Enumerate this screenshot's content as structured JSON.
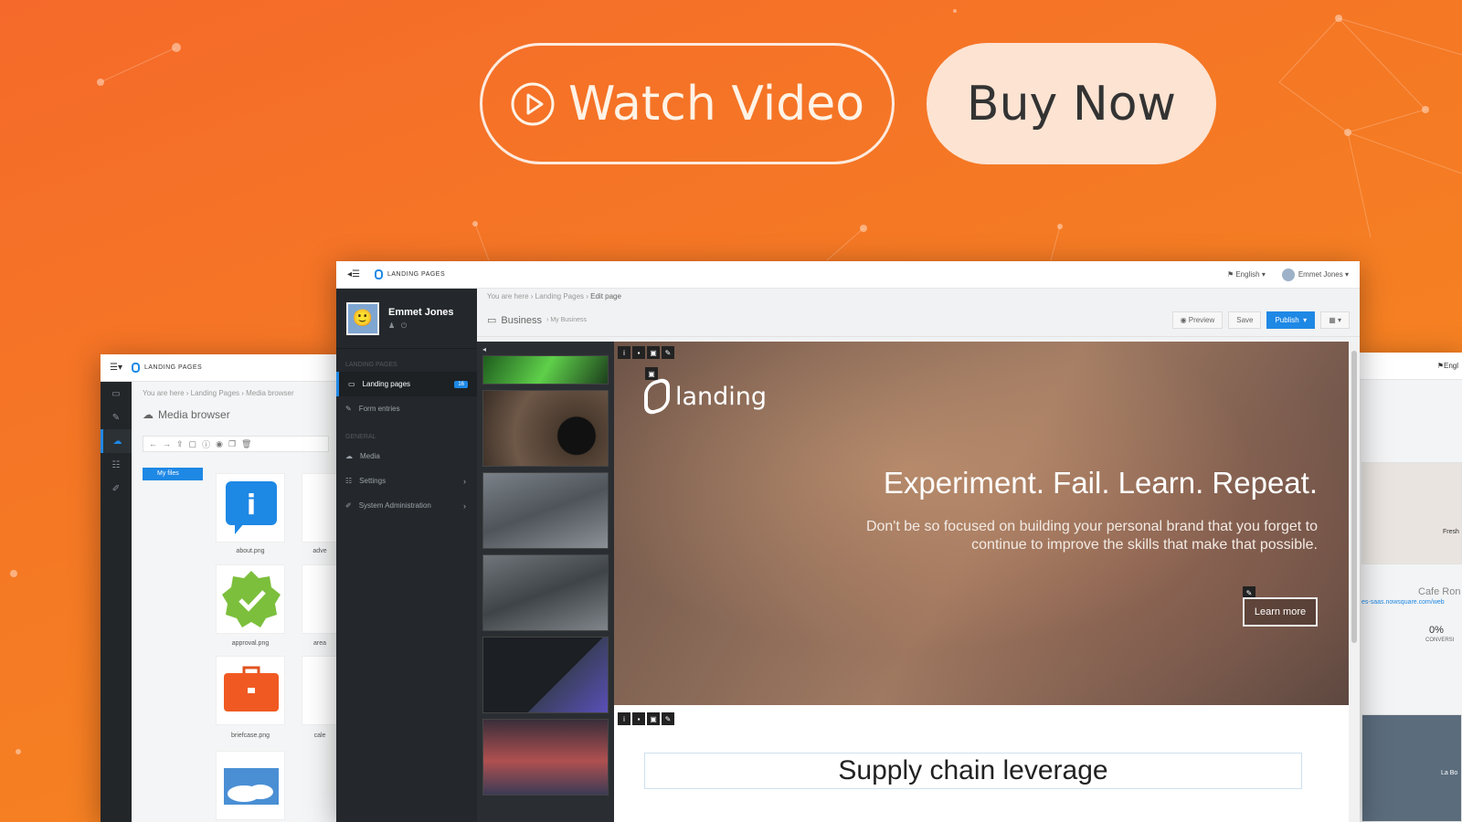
{
  "hero": {
    "watch_label": "Watch Video",
    "buy_label": "Buy Now"
  },
  "left_window": {
    "app_title": "LANDING PAGES",
    "breadcrumb": [
      "You are here",
      "Landing Pages",
      "Media browser"
    ],
    "page_title": "Media browser",
    "folder_label": "My files",
    "files": [
      {
        "name": "about.png",
        "icon": "info-bubble-icon"
      },
      {
        "name": "approval.png",
        "icon": "check-badge-icon"
      },
      {
        "name": "briefcase.png",
        "icon": "briefcase-icon"
      },
      {
        "name": "",
        "icon": "cloud-image-icon"
      }
    ],
    "partial_files": [
      "adve",
      "area",
      "cale"
    ]
  },
  "main_window": {
    "app_title": "LANDING PAGES",
    "language": "English",
    "user_menu": "Emmet Jones",
    "user_name": "Emmet Jones",
    "sidebar": {
      "section_1": "LANDING PAGES",
      "section_2": "GENERAL",
      "items": [
        {
          "label": "Landing pages",
          "icon": "monitor-icon",
          "badge": "16"
        },
        {
          "label": "Form entries",
          "icon": "edit-icon"
        },
        {
          "label": "Media",
          "icon": "cloud-icon"
        },
        {
          "label": "Settings",
          "icon": "sliders-icon"
        },
        {
          "label": "System Administration",
          "icon": "wrench-icon"
        }
      ]
    },
    "breadcrumb": [
      "You are here",
      "Landing Pages",
      "Edit page"
    ],
    "page_title": "Business",
    "page_subtitle": "My Business",
    "actions": {
      "preview": "Preview",
      "save": "Save",
      "publish": "Publish"
    },
    "editor": {
      "logo_text": "landing",
      "headline": "Experiment. Fail. Learn. Repeat.",
      "body": "Don't be so focused on building your personal brand that you forget to continue to improve the skills that make that possible.",
      "cta": "Learn more",
      "section2_title": "Supply chain leverage"
    }
  },
  "right_window": {
    "language": "Engl",
    "card_title": "Cafe Ron",
    "card_url": "es-saas.nowsquare.com/web",
    "stat_value": "0%",
    "stat_label": "CONVERSI",
    "thumb_label": "Fresh",
    "thumb_label2": "La Bo"
  },
  "colors": {
    "brand_orange": "#f57a24",
    "accent_blue": "#1e88e5",
    "sidebar_dark": "#24282c"
  }
}
